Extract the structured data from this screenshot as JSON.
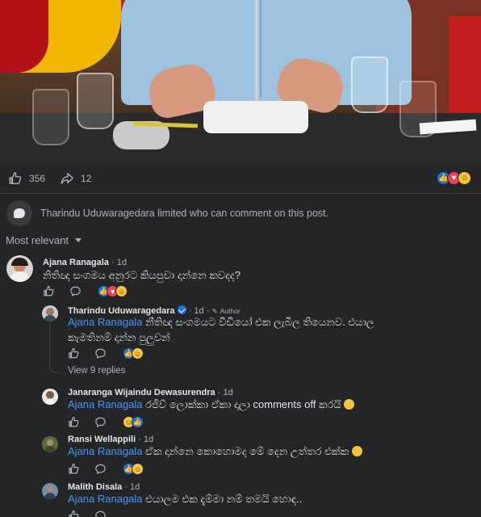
{
  "post": {
    "like_count": "356",
    "share_count": "12",
    "reaction_icons": [
      "like-icon",
      "love-icon",
      "haha-icon"
    ]
  },
  "notice": {
    "text": "Tharindu Uduwaragedara limited who can comment on this post."
  },
  "sort": {
    "label": "Most relevant"
  },
  "comments": [
    {
      "author": "Ajana Ranagala",
      "time": "· 1d",
      "text": "නිතිඥ සංගමය අනුරට කියපුවා දාන්නෙ කවදද?",
      "reactions": [
        "like-icon",
        "love-icon",
        "haha-icon"
      ]
    },
    {
      "author": "Tharindu Uduwaragedara",
      "time": "· 1d ·",
      "badge": "Author",
      "mention": "Ajana Ranagala",
      "text_line1": "නීතිඥ සංගමයට විඩියෝ එක ලැබිල තියෙනව. එයාල",
      "text_line2": "කැමතිනම් දාන්න පුලුවන්",
      "reactions": [
        "like-icon",
        "haha-icon"
      ],
      "view_replies": "View 9 replies"
    },
    {
      "author": "Janaranga Wijaindu Dewasurendra",
      "time": "· 1d",
      "mention": "Ajana Ranagala",
      "text": "රජීව් ලොක්කා ඒකා දාලා comments off කරයි",
      "reactions": [
        "haha-icon",
        "like-icon"
      ]
    },
    {
      "author": "Ransi Wellappili",
      "time": "· 1d",
      "mention": "Ajana Ranagala",
      "text": "ඒක දාන්නෙ කොහොමද මේ දෙන උත්තර එක්ක",
      "reactions": [
        "like-icon",
        "haha-icon"
      ]
    },
    {
      "author": "Malith Disala",
      "time": "· 1d",
      "mention": "Ajana Ranagala",
      "text": "එයාලම එක දැම්මා නම් තමයි හොඳ.."
    }
  ],
  "colors": {
    "background": "#242526",
    "text": "#e4e6eb",
    "muted": "#b0b3b8",
    "mention": "#4599ff",
    "like_blue": "#1b74e4",
    "love_red": "#f33e58",
    "haha_yellow": "#f7c439"
  }
}
